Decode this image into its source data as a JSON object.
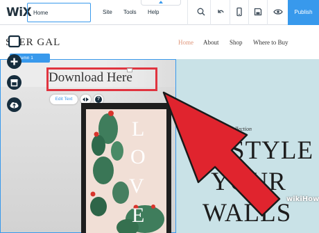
{
  "editor": {
    "logo": "WiX",
    "page_selector": "Home",
    "menu": {
      "site": "Site",
      "tools": "Tools",
      "help": "Help"
    },
    "publish_label": "Publish",
    "accent_color": "#3899ec"
  },
  "site": {
    "brand": "STER GAL",
    "nav": {
      "home": "Home",
      "about": "About",
      "shop": "Shop",
      "where": "Where to Buy"
    },
    "column_tag": "Column 1",
    "download_text": "Download Here",
    "edit_text_label": "Edit Text",
    "help_label": "?",
    "poster_letters": [
      "L",
      "O",
      "V",
      "E"
    ],
    "collection": "llection",
    "headline": [
      "STYLE",
      "YOUR",
      "WALLS"
    ]
  },
  "overlay": {
    "arrow_color": "#e0242e",
    "highlight_color": "#e0343f",
    "watermark": "wikiHow"
  }
}
